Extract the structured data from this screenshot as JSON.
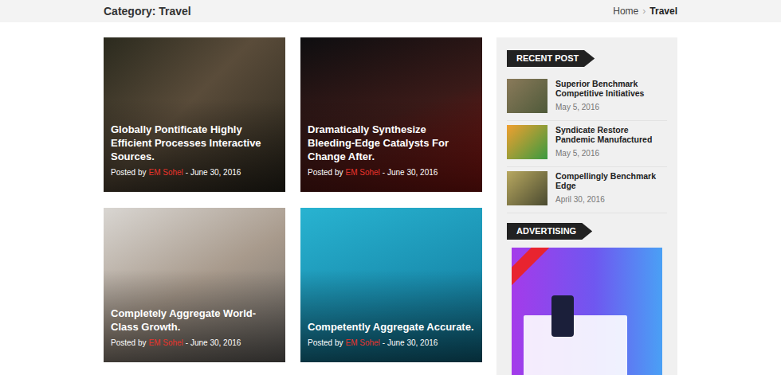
{
  "header": {
    "title": "Category: Travel",
    "breadcrumb": [
      {
        "label": "Home",
        "selected": false
      },
      {
        "label": "Travel",
        "selected": true
      }
    ],
    "separator": "›"
  },
  "posts": [
    {
      "title": "Globally Pontificate Highly Efficient Processes Interactive Sources.",
      "posted_by": "Posted by",
      "author": "EM Sohel",
      "date": "- June 30, 2016"
    },
    {
      "title": "Dramatically Synthesize Bleeding-Edge Catalysts For Change After.",
      "posted_by": "Posted by",
      "author": "EM Sohel",
      "date": "- June 30, 2016"
    },
    {
      "title": "Completely Aggregate World-Class Growth.",
      "posted_by": "Posted by",
      "author": "EM Sohel",
      "date": "- June 30, 2016"
    },
    {
      "title": "Competently Aggregate Accurate.",
      "posted_by": "Posted by",
      "author": "EM Sohel",
      "date": "- June 30, 2016"
    }
  ],
  "sidebar": {
    "recent": {
      "heading": "RECENT POST",
      "items": [
        {
          "title": "Superior Benchmark Competitive Initiatives",
          "date": "May 5, 2016"
        },
        {
          "title": "Syndicate Restore Pandemic Manufactured",
          "date": "May 5, 2016"
        },
        {
          "title": "Compellingly Benchmark Edge",
          "date": "April 30, 2016"
        }
      ]
    },
    "advertising": {
      "heading": "ADVERTISING"
    }
  }
}
